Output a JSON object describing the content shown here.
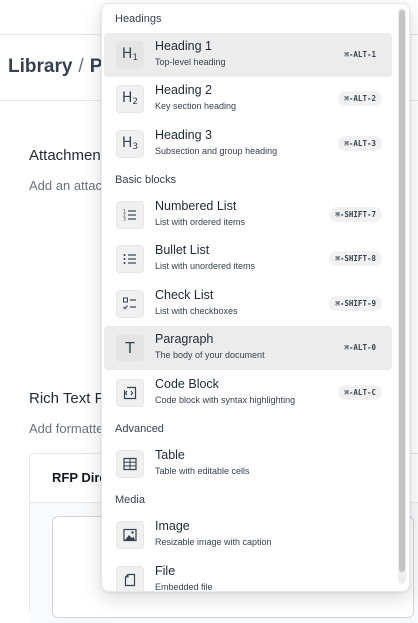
{
  "background": {
    "breadcrumb": {
      "root": "Library",
      "separator": "/",
      "current": "P"
    },
    "attachments": {
      "title": "Attachment",
      "description": "Add an attac"
    },
    "rich_text": {
      "title": "Rich Text F",
      "description": "Add formatte"
    },
    "card": {
      "title": "RFP Dire"
    }
  },
  "menu": {
    "groups": [
      {
        "label": "Headings",
        "items": [
          {
            "icon": "heading-1-icon",
            "glyph": "H",
            "sub": "1",
            "title": "Heading 1",
            "description": "Top-level heading",
            "shortcut": "⌘-ALT-1",
            "highlighted": true
          },
          {
            "icon": "heading-2-icon",
            "glyph": "H",
            "sub": "2",
            "title": "Heading 2",
            "description": "Key section heading",
            "shortcut": "⌘-ALT-2",
            "highlighted": false
          },
          {
            "icon": "heading-3-icon",
            "glyph": "H",
            "sub": "3",
            "title": "Heading 3",
            "description": "Subsection and group heading",
            "shortcut": "⌘-ALT-3",
            "highlighted": false
          }
        ]
      },
      {
        "label": "Basic blocks",
        "items": [
          {
            "icon": "numbered-list-icon",
            "title": "Numbered List",
            "description": "List with ordered items",
            "shortcut": "⌘-SHIFT-7",
            "highlighted": false
          },
          {
            "icon": "bullet-list-icon",
            "title": "Bullet List",
            "description": "List with unordered items",
            "shortcut": "⌘-SHIFT-8",
            "highlighted": false
          },
          {
            "icon": "check-list-icon",
            "title": "Check List",
            "description": "List with checkboxes",
            "shortcut": "⌘-SHIFT-9",
            "highlighted": false
          },
          {
            "icon": "paragraph-icon",
            "glyph": "T",
            "title": "Paragraph",
            "description": "The body of your document",
            "shortcut": "⌘-ALT-0",
            "highlighted": true
          },
          {
            "icon": "code-block-icon",
            "title": "Code Block",
            "description": "Code block with syntax highlighting",
            "shortcut": "⌘-ALT-C",
            "highlighted": false
          }
        ]
      },
      {
        "label": "Advanced",
        "items": [
          {
            "icon": "table-icon",
            "title": "Table",
            "description": "Table with editable cells",
            "highlighted": false
          }
        ]
      },
      {
        "label": "Media",
        "items": [
          {
            "icon": "image-icon",
            "title": "Image",
            "description": "Resizable image with caption",
            "highlighted": false
          },
          {
            "icon": "file-icon",
            "title": "File",
            "description": "Embedded file",
            "highlighted": false
          }
        ]
      }
    ]
  }
}
